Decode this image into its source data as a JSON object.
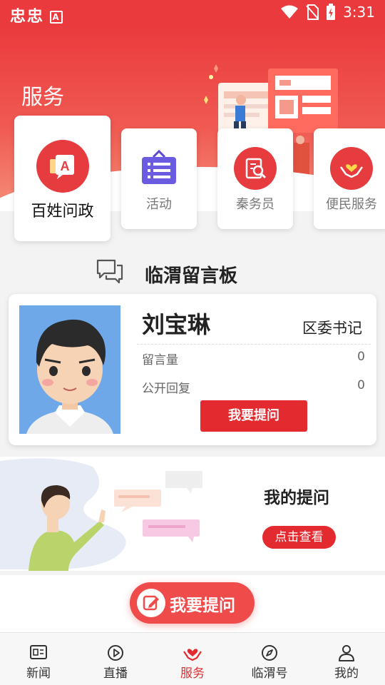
{
  "status_bar": {
    "left_glyphs": "忠忠",
    "badge_letter": "A",
    "time": "3:31"
  },
  "header": {
    "title": "服务"
  },
  "service_cards": [
    {
      "label": "百姓问政",
      "icon": "chat-a-icon"
    },
    {
      "label": "活动",
      "icon": "calendar-list-icon"
    },
    {
      "label": "秦务员",
      "icon": "search-document-icon"
    },
    {
      "label": "便民服务",
      "icon": "heart-hands-icon"
    }
  ],
  "board": {
    "title": "临渭留言板",
    "icon": "speech-bubbles-icon"
  },
  "profile": {
    "name": "刘宝琳",
    "role": "区委书记",
    "messages_label": "留言量",
    "messages_value": "0",
    "replies_label": "公开回复",
    "replies_value": "0",
    "ask_button": "我要提问"
  },
  "my_questions": {
    "title": "我的提问",
    "view_button": "点击查看"
  },
  "floating_button": {
    "label": "我要提问",
    "icon": "edit-icon"
  },
  "tabbar": {
    "tabs": [
      {
        "label": "新闻",
        "icon": "newspaper-icon",
        "active": false
      },
      {
        "label": "直播",
        "icon": "play-icon",
        "active": false
      },
      {
        "label": "服务",
        "icon": "heart-hand-icon",
        "active": true
      },
      {
        "label": "临渭号",
        "icon": "compass-icon",
        "active": false
      },
      {
        "label": "我的",
        "icon": "person-icon",
        "active": false
      }
    ]
  },
  "colors": {
    "primary": "#e32b2f",
    "header_top": "#ea3a3d",
    "header_bottom": "#f58e7a",
    "activity_icon": "#6b5be0"
  }
}
